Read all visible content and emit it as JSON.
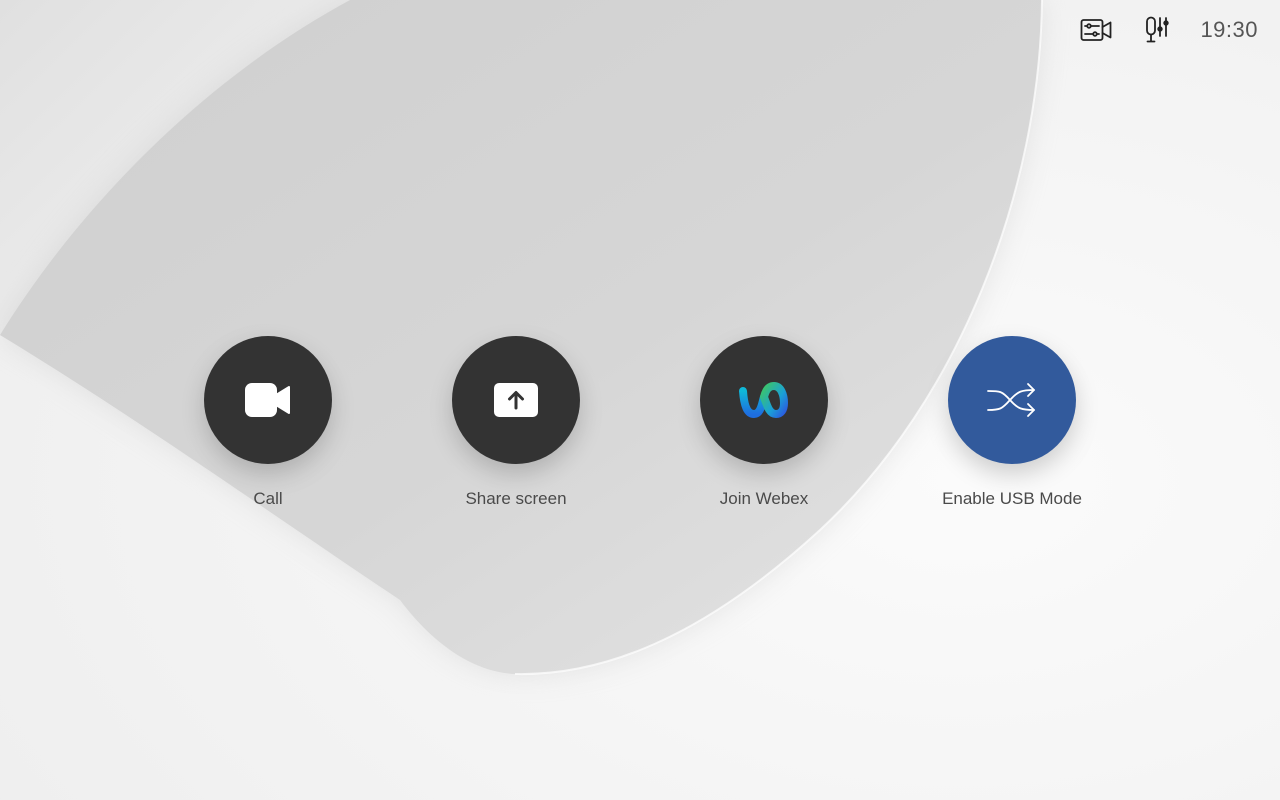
{
  "topbar": {
    "clock": "19:30",
    "icons": [
      "camera-settings-icon",
      "microphone-settings-icon"
    ]
  },
  "actions": [
    {
      "label": "Call",
      "icon": "video-camera-icon",
      "color": "#333333"
    },
    {
      "label": "Share screen",
      "icon": "share-upload-icon",
      "color": "#333333"
    },
    {
      "label": "Join Webex",
      "icon": "webex-logo-icon",
      "color": "#333333"
    },
    {
      "label": "Enable USB Mode",
      "icon": "shuffle-icon",
      "color": "#325a9c"
    }
  ],
  "colors": {
    "button_dark": "#333333",
    "button_accent": "#325a9c",
    "label_text": "#4a4a4a",
    "background": "#f3f3f3"
  }
}
